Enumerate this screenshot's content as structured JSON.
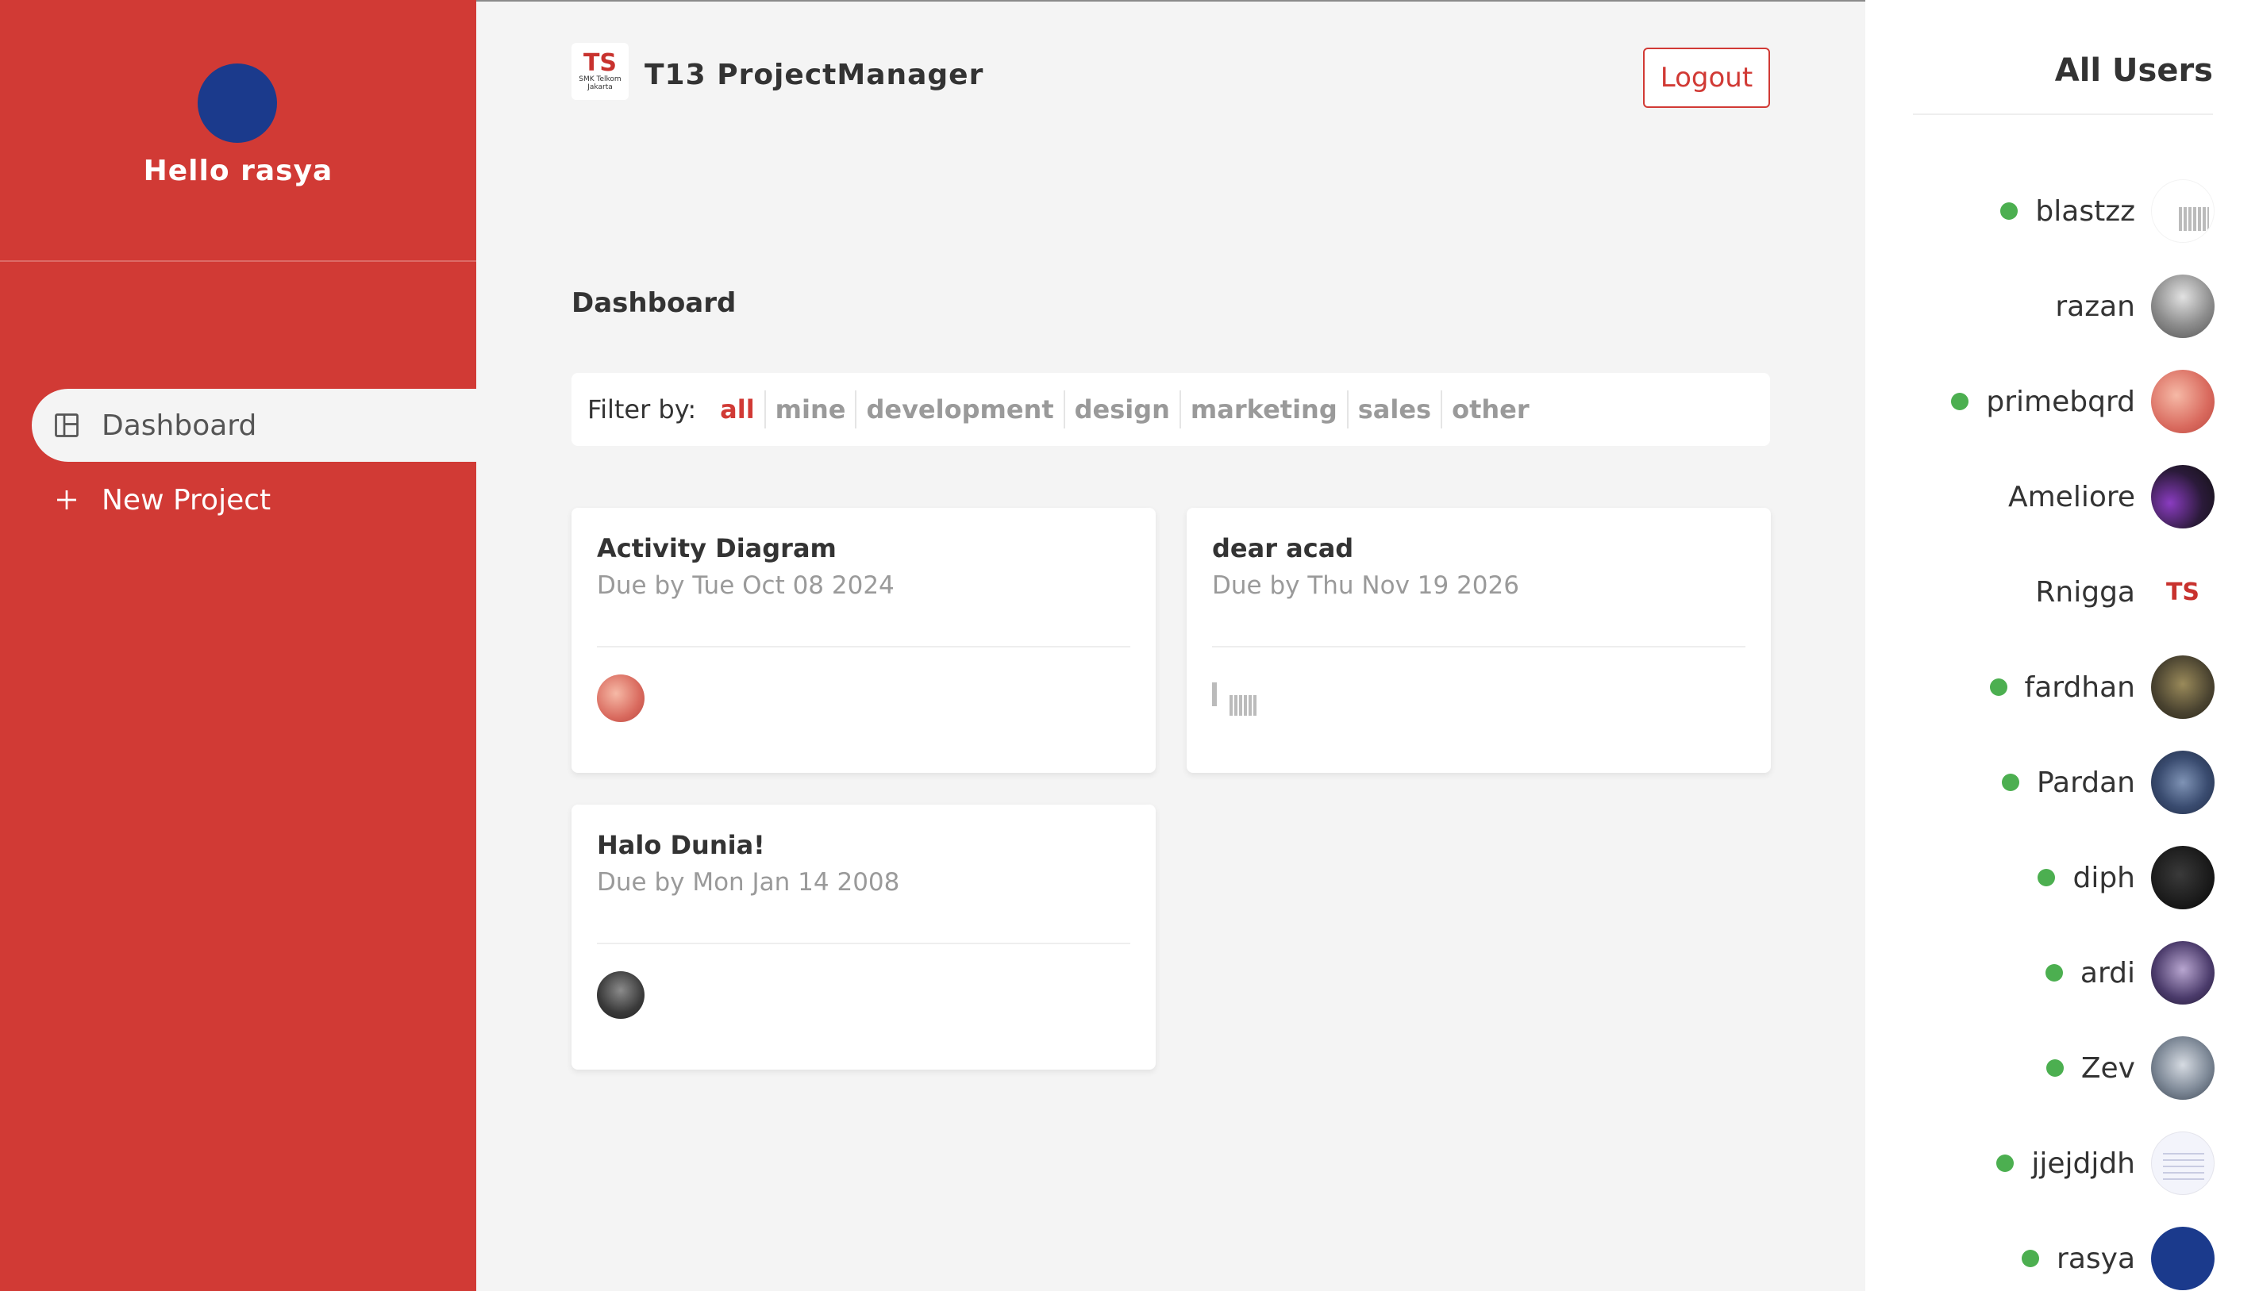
{
  "sidebar": {
    "greeting": "Hello rasya",
    "avatar_color": "#1b3a8c",
    "nav": [
      {
        "label": "Dashboard",
        "icon": "layout-icon",
        "active": true
      },
      {
        "label": "New Project",
        "icon": "plus-icon",
        "active": false
      }
    ],
    "accent": "#d13a35"
  },
  "header": {
    "brand_title": "T13 ProjectManager",
    "logo_glyph": "TS",
    "logo_text": "SMK Telkom Jakarta",
    "logout_label": "Logout"
  },
  "main": {
    "page_title": "Dashboard",
    "filter": {
      "label": "Filter by:",
      "options": [
        "all",
        "mine",
        "development",
        "design",
        "marketing",
        "sales",
        "other"
      ],
      "active": "all"
    },
    "projects": [
      {
        "title": "Activity Diagram",
        "due": "Due by Tue Oct 08 2024"
      },
      {
        "title": "dear acad",
        "due": "Due by Thu Nov 19 2026"
      },
      {
        "title": "Halo Dunia!",
        "due": "Due by Mon Jan 14 2008"
      }
    ]
  },
  "users_panel": {
    "title": "All Users",
    "online_color": "#4caf50",
    "users": [
      {
        "name": "blastzz",
        "online": true
      },
      {
        "name": "razan",
        "online": false
      },
      {
        "name": "primebqrd",
        "online": true
      },
      {
        "name": "Ameliore",
        "online": false
      },
      {
        "name": "Rnigga",
        "online": false,
        "avatar_glyph": "TS"
      },
      {
        "name": "fardhan",
        "online": true
      },
      {
        "name": "Pardan",
        "online": true
      },
      {
        "name": "diph",
        "online": true
      },
      {
        "name": "ardi",
        "online": true
      },
      {
        "name": "Zev",
        "online": true
      },
      {
        "name": "jjejdjdh",
        "online": true
      },
      {
        "name": "rasya",
        "online": true
      }
    ]
  }
}
